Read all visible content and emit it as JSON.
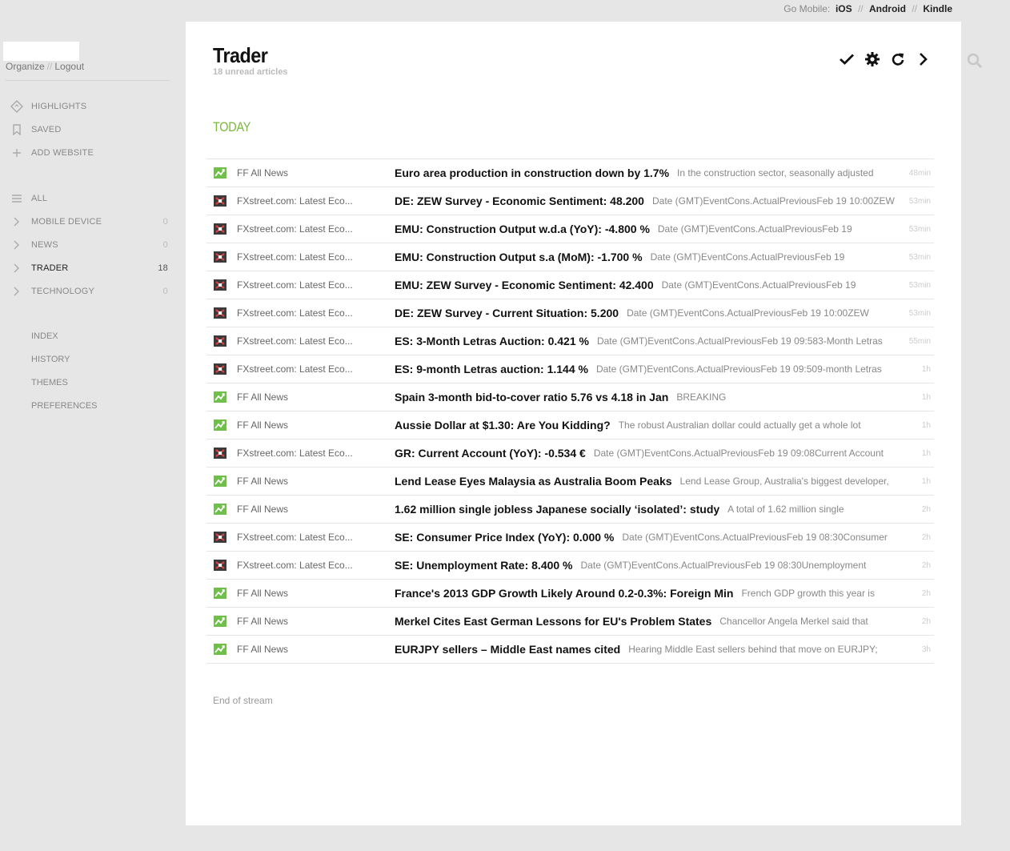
{
  "topbar": {
    "label": "Go Mobile:",
    "links": [
      "iOS",
      "Android",
      "Kindle"
    ]
  },
  "account": {
    "organize": "Organize",
    "logout": "Logout",
    "sep": "//"
  },
  "sidebar": {
    "top_items": [
      {
        "label": "Highlights",
        "icon": "highlights-icon"
      },
      {
        "label": "Saved",
        "icon": "bookmark-icon"
      },
      {
        "label": "Add Website",
        "icon": "plus-icon"
      }
    ],
    "all_label": "All",
    "categories": [
      {
        "label": "Mobile Device",
        "count": "0"
      },
      {
        "label": "News",
        "count": "0"
      },
      {
        "label": "Trader",
        "count": "18"
      },
      {
        "label": "Technology",
        "count": "0"
      }
    ],
    "bottom_items": [
      "Index",
      "History",
      "Themes",
      "Preferences"
    ]
  },
  "main": {
    "title": "Trader",
    "subtitle": "18 unread articles",
    "section": "Today",
    "end_text": "End of stream",
    "accent_color": "#7ab83a"
  },
  "articles": [
    {
      "source": "FF All News",
      "feed": "ff",
      "title": "Euro area production in construction down by 1.7%",
      "snippet": "In the construction sector, seasonally adjusted",
      "age": "48min"
    },
    {
      "source": "FXstreet.com: Latest Eco...",
      "feed": "fx",
      "title": "DE: ZEW Survey - Economic Sentiment: 48.200",
      "snippet": "Date (GMT)EventCons.ActualPreviousFeb 19 10:00ZEW",
      "age": "53min"
    },
    {
      "source": "FXstreet.com: Latest Eco...",
      "feed": "fx",
      "title": "EMU: Construction Output w.d.a (YoY): -4.800 %",
      "snippet": "Date (GMT)EventCons.ActualPreviousFeb 19",
      "age": "53min"
    },
    {
      "source": "FXstreet.com: Latest Eco...",
      "feed": "fx",
      "title": "EMU: Construction Output s.a (MoM): -1.700 %",
      "snippet": "Date (GMT)EventCons.ActualPreviousFeb 19",
      "age": "53min"
    },
    {
      "source": "FXstreet.com: Latest Eco...",
      "feed": "fx",
      "title": "EMU: ZEW Survey - Economic Sentiment: 42.400",
      "snippet": "Date (GMT)EventCons.ActualPreviousFeb 19",
      "age": "53min"
    },
    {
      "source": "FXstreet.com: Latest Eco...",
      "feed": "fx",
      "title": "DE: ZEW Survey - Current Situation: 5.200",
      "snippet": "Date (GMT)EventCons.ActualPreviousFeb 19 10:00ZEW",
      "age": "53min"
    },
    {
      "source": "FXstreet.com: Latest Eco...",
      "feed": "fx",
      "title": "ES: 3-Month Letras Auction: 0.421 %",
      "snippet": "Date (GMT)EventCons.ActualPreviousFeb 19 09:583-Month Letras",
      "age": "55min"
    },
    {
      "source": "FXstreet.com: Latest Eco...",
      "feed": "fx",
      "title": "ES: 9-month Letras auction: 1.144 %",
      "snippet": "Date (GMT)EventCons.ActualPreviousFeb 19 09:509-month Letras",
      "age": "1h"
    },
    {
      "source": "FF All News",
      "feed": "ff",
      "title": "Spain 3-month bid-to-cover ratio 5.76 vs 4.18 in Jan",
      "snippet": "BREAKING",
      "age": "1h"
    },
    {
      "source": "FF All News",
      "feed": "ff",
      "title": "Aussie Dollar at $1.30: Are You Kidding?",
      "snippet": "The robust Australian dollar could actually get a whole lot",
      "age": "1h"
    },
    {
      "source": "FXstreet.com: Latest Eco...",
      "feed": "fx",
      "title": "GR: Current Account (YoY): -0.534 €",
      "snippet": "Date (GMT)EventCons.ActualPreviousFeb 19 09:08Current Account",
      "age": "1h"
    },
    {
      "source": "FF All News",
      "feed": "ff",
      "title": "Lend Lease Eyes Malaysia as Australia Boom Peaks",
      "snippet": "Lend Lease Group, Australia's biggest developer,",
      "age": "1h"
    },
    {
      "source": "FF All News",
      "feed": "ff",
      "title": "1.62 million single jobless Japanese socially ‘isolated’: study",
      "snippet": "A total of 1.62 million single",
      "age": "2h"
    },
    {
      "source": "FXstreet.com: Latest Eco...",
      "feed": "fx",
      "title": "SE: Consumer Price Index (YoY): 0.000 %",
      "snippet": "Date (GMT)EventCons.ActualPreviousFeb 19 08:30Consumer",
      "age": "2h"
    },
    {
      "source": "FXstreet.com: Latest Eco...",
      "feed": "fx",
      "title": "SE: Unemployment Rate: 8.400 %",
      "snippet": "Date (GMT)EventCons.ActualPreviousFeb 19 08:30Unemployment",
      "age": "2h"
    },
    {
      "source": "FF All News",
      "feed": "ff",
      "title": "France's 2013 GDP Growth Likely Around 0.2-0.3%: Foreign Min",
      "snippet": "French GDP growth this year is",
      "age": "2h"
    },
    {
      "source": "FF All News",
      "feed": "ff",
      "title": "Merkel Cites East German Lessons for EU's Problem States",
      "snippet": "Chancellor Angela Merkel said that",
      "age": "2h"
    },
    {
      "source": "FF All News",
      "feed": "ff",
      "title": "EURJPY sellers – Middle East names cited",
      "snippet": "Hearing Middle East sellers behind that move on EURJPY;",
      "age": "3h"
    }
  ]
}
